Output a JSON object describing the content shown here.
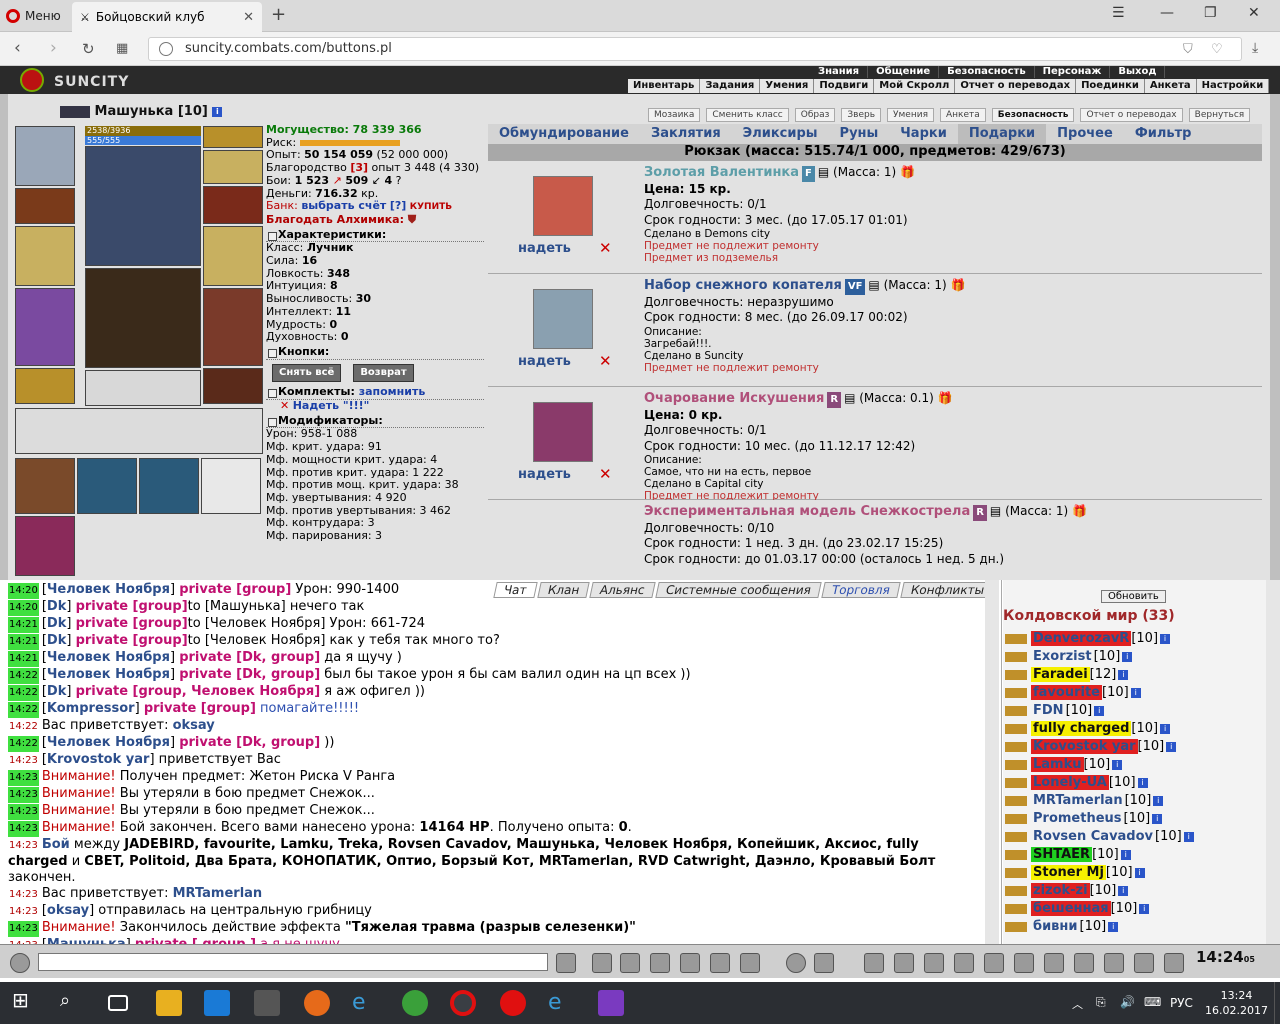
{
  "browser": {
    "menu_label": "Меню",
    "tab_title": "Бойцовский клуб",
    "url": "suncity.combats.com/buttons.pl"
  },
  "game": {
    "logo": "SUNCITY",
    "top_menu": [
      "Знания",
      "Общение",
      "Безопасность",
      "Персонаж",
      "Выход"
    ],
    "sub_menu": [
      "Инвентарь",
      "Задания",
      "Умения",
      "Подвиги",
      "Мой Скролл",
      "Отчет о переводах",
      "Поединки",
      "Анкета",
      "Настройки"
    ]
  },
  "character": {
    "name": "Машунька",
    "level": "[10]",
    "hp": "2538/3936",
    "mp": "555/555",
    "power": "Могущество: 78 339 366",
    "risk_label": "Риск:",
    "exp": "Опыт:",
    "exp_val": "50 154 059",
    "exp_next": "(52 000 000)",
    "nobility": "Благородство",
    "nobility_val": "[3]",
    "nobility_rest": "опыт 3 448 (4 330)",
    "fights": "Бои:",
    "fights_val": "1 523",
    "fights_w": "509",
    "fights_d": "4",
    "money": "Деньги:",
    "money_val": "716.32",
    "money_unit": "кр.",
    "bank": "Банк:",
    "bank_link": "выбрать счёт",
    "bank_q": "[?]",
    "bank_buy": "КУПИТЬ",
    "thank": "Благодать Алхимика:",
    "sec_chars": "Характеристики:",
    "class": "Класс:",
    "class_val": "Лучник",
    "str": "Сила:",
    "str_val": "16",
    "agi": "Ловкость:",
    "agi_val": "348",
    "int": "Интуиция:",
    "int_val": "8",
    "end": "Выносливость:",
    "end_val": "30",
    "intel": "Интеллект:",
    "intel_val": "11",
    "wis": "Мудрость:",
    "wis_val": "0",
    "spir": "Духовность:",
    "spir_val": "0",
    "sec_buttons": "Кнопки:",
    "btn_remove": "Снять всё",
    "btn_return": "Возврат",
    "sec_sets": "Комплекты:",
    "remember": "запомнить",
    "set_name": "Надеть \"!!!\"",
    "sec_mods": "Модификаторы:",
    "mods": [
      "Урон: 958-1 088",
      "Мф. крит. удара: 91",
      "Мф. мощности крит. удара: 4",
      "Мф. против крит. удара: 1 222",
      "Мф. против мощ. крит. удара: 38",
      "Мф. увертывания: 4 920",
      "Мф. против увертывания: 3 462",
      "Мф. контрудара: 3",
      "Мф. парирования: 3"
    ]
  },
  "panel": {
    "top_buttons": [
      "Мозаика",
      "Сменить класс",
      "Образ",
      "Зверь",
      "Умения",
      "Анкета",
      "Безопасность",
      "Отчет о переводах",
      "Вернуться"
    ],
    "tabs": [
      "Обмундирование",
      "Заклятия",
      "Эликсиры",
      "Руны",
      "Чарки",
      "Подарки",
      "Прочее",
      "Фильтр"
    ],
    "active_tab": "Подарки",
    "backpack": "Рюкзак (масса: 515.74/1 000, предметов: 429/673)",
    "wear_label": "надеть",
    "items": [
      {
        "name": "Золотая Валентинка",
        "tag": "F",
        "mass": "(Масса: 1)",
        "lines": [
          "Цена: 15 кр.",
          "Долговечность: 0/1",
          "Срок годности: 3 мес. (до 17.05.17 01:01)"
        ],
        "small": [
          "Сделано в Demons city"
        ],
        "warn": [
          "Предмет не подлежит ремонту",
          "Предмет из подземелья"
        ]
      },
      {
        "name": "Набор снежного копателя",
        "tag": "VF",
        "mass": "(Масса: 1)",
        "lines": [
          "Долговечность: неразрушимо",
          "Срок годности: 8 мес. (до 26.09.17 00:02)"
        ],
        "small": [
          "Описание:",
          "Загребай!!!.",
          "Сделано в Suncity"
        ],
        "warn": [
          "Предмет не подлежит ремонту"
        ]
      },
      {
        "name": "Очарование Искушения",
        "tag": "R",
        "mass": "(Масса: 0.1)",
        "lines": [
          "Цена: 0 кр.",
          "Долговечность: 0/1",
          "Срок годности: 10 мес. (до 11.12.17 12:42)"
        ],
        "small": [
          "Описание:",
          "Самое, что ни на есть, первое",
          "Сделано в Capital city"
        ],
        "warn": [
          "Предмет не подлежит ремонту"
        ]
      },
      {
        "name": "Экспериментальная модель Снежкострела",
        "tag": "R",
        "mass": "(Масса: 1)",
        "lines": [
          "Долговечность: 0/10",
          "Срок годности: 1 нед. 3 дн. (до 23.02.17 15:25)",
          "Срок годности: до 01.03.17 00:00 (осталось 1 нед. 5 дн.)"
        ],
        "small": [],
        "warn": []
      }
    ]
  },
  "chat": {
    "tabs": [
      "Чат",
      "Клан",
      "Альянс",
      "Системные сообщения",
      "Торговля",
      "Конфликты"
    ],
    "lines": [
      {
        "t": "14:20",
        "parts": [
          [
            "",
            "["
          ],
          [
            "nick",
            "Человек Ноября"
          ],
          [
            "",
            "] "
          ],
          [
            "priv",
            "private [group]"
          ],
          [
            "",
            " Урон: 990-1400"
          ]
        ]
      },
      {
        "t": "14:20",
        "parts": [
          [
            "",
            "["
          ],
          [
            "nick",
            "Dk"
          ],
          [
            "",
            "] "
          ],
          [
            "priv",
            "private [group]"
          ],
          [
            "",
            "to [Машунька] нечего так"
          ]
        ]
      },
      {
        "t": "14:21",
        "parts": [
          [
            "",
            "["
          ],
          [
            "nick",
            "Dk"
          ],
          [
            "",
            "] "
          ],
          [
            "priv",
            "private [group]"
          ],
          [
            "",
            "to [Человек Ноября] Урон: 661-724"
          ]
        ]
      },
      {
        "t": "14:21",
        "parts": [
          [
            "",
            "["
          ],
          [
            "nick",
            "Dk"
          ],
          [
            "",
            "] "
          ],
          [
            "priv",
            "private [group]"
          ],
          [
            "",
            "to [Человек Ноября] как у тебя так много то?"
          ]
        ]
      },
      {
        "t": "14:21",
        "parts": [
          [
            "",
            "["
          ],
          [
            "nick",
            "Человек Ноября"
          ],
          [
            "",
            "] "
          ],
          [
            "priv",
            "private [Dk, group]"
          ],
          [
            "",
            " да я щучу )"
          ]
        ]
      },
      {
        "t": "14:22",
        "parts": [
          [
            "",
            "["
          ],
          [
            "nick",
            "Человек Ноября"
          ],
          [
            "",
            "] "
          ],
          [
            "priv",
            "private [Dk, group]"
          ],
          [
            "",
            " был бы такое урон я бы сам валил один на цп всех ))"
          ]
        ]
      },
      {
        "t": "14:22",
        "parts": [
          [
            "",
            "["
          ],
          [
            "nick",
            "Dk"
          ],
          [
            "",
            "] "
          ],
          [
            "priv",
            "private [group, Человек Ноября]"
          ],
          [
            "",
            " я аж офигел ))"
          ]
        ]
      },
      {
        "t": "14:22",
        "parts": [
          [
            "",
            "["
          ],
          [
            "nick",
            "Kompressor"
          ],
          [
            "",
            "] "
          ],
          [
            "priv",
            "private [group]"
          ],
          [
            "nick2",
            " помагайте!!!!!"
          ]
        ]
      },
      {
        "t": "14:22",
        "n": 1,
        "parts": [
          [
            "",
            "Вас приветствует: "
          ],
          [
            "nick",
            "oksay"
          ]
        ]
      },
      {
        "t": "14:22",
        "parts": [
          [
            "",
            "["
          ],
          [
            "nick",
            "Человек Ноября"
          ],
          [
            "",
            "] "
          ],
          [
            "priv",
            "private [Dk, group]"
          ],
          [
            "",
            " ))"
          ]
        ]
      },
      {
        "t": "14:23",
        "n": 1,
        "parts": [
          [
            "",
            "["
          ],
          [
            "nick",
            "Krovostok yar"
          ],
          [
            "",
            "] приветствует Вас"
          ]
        ]
      },
      {
        "t": "14:23",
        "parts": [
          [
            "warn",
            "Внимание!"
          ],
          [
            "",
            " Получен предмет: Жетон Риска V Ранга"
          ]
        ]
      },
      {
        "t": "14:23",
        "parts": [
          [
            "warn",
            "Внимание!"
          ],
          [
            "",
            " Вы утеряли в бою предмет Снежок..."
          ]
        ]
      },
      {
        "t": "14:23",
        "parts": [
          [
            "warn",
            "Внимание!"
          ],
          [
            "",
            " Вы утеряли в бою предмет Снежок..."
          ]
        ]
      },
      {
        "t": "14:23",
        "parts": [
          [
            "warn",
            "Внимание!"
          ],
          [
            "",
            " Бой закончен. Всего вами нанесено урона: "
          ],
          [
            "b",
            "14164 HP"
          ],
          [
            "",
            ". Получено опыта: "
          ],
          [
            "b",
            "0"
          ],
          [
            "",
            "."
          ]
        ]
      },
      {
        "t": "14:23",
        "n": 1,
        "parts": [
          [
            "nick",
            "Бой"
          ],
          [
            "",
            " между "
          ],
          [
            "b",
            "JADEBIRD, favourite, Lamku, Treka, Rovsen Cavadov, Машунька, Человек Ноября, Копейшик, Аксиос, fully"
          ]
        ]
      },
      {
        "t": "",
        "parts": [
          [
            "b",
            "charged"
          ],
          [
            "",
            " и "
          ],
          [
            "b",
            "CBET, Politoid, Два Брата, КОНОПАТИК, Оптио, Борзый Кот, MRTamerlan, RVD Catwright, Даэнло, Кровавый Болт"
          ]
        ]
      },
      {
        "t": "",
        "parts": [
          [
            "",
            "закончен."
          ]
        ]
      },
      {
        "t": "14:23",
        "n": 1,
        "parts": [
          [
            "",
            "Вас приветствует: "
          ],
          [
            "nick",
            "MRTamerlan"
          ]
        ]
      },
      {
        "t": "14:23",
        "n": 1,
        "parts": [
          [
            "",
            "["
          ],
          [
            "nick",
            "oksay"
          ],
          [
            "",
            "] отправилась на центральную грибницу"
          ]
        ]
      },
      {
        "t": "14:23",
        "parts": [
          [
            "warn",
            "Внимание!"
          ],
          [
            "",
            " Закончилось действие эффекта "
          ],
          [
            "b",
            "\"Тяжелая травма (разрыв селезенки)\""
          ]
        ]
      },
      {
        "t": "14:23",
        "n": 1,
        "parts": [
          [
            "",
            "["
          ],
          [
            "nick",
            "Машунька"
          ],
          [
            "",
            "] "
          ],
          [
            "priv",
            "private [ group ]"
          ],
          [
            "priv2",
            " а я не шучу"
          ]
        ]
      }
    ]
  },
  "online": {
    "refresh": "Обновить",
    "title": "Колдовской мир (33)",
    "users": [
      {
        "name": "DenverozavR",
        "lvl": "[10]",
        "hl": "red"
      },
      {
        "name": "Exorzist",
        "lvl": "[10]",
        "hl": ""
      },
      {
        "name": "Faradei",
        "lvl": "[12]",
        "hl": "yel"
      },
      {
        "name": "favourite",
        "lvl": "[10]",
        "hl": "red"
      },
      {
        "name": "FDN",
        "lvl": "[10]",
        "hl": ""
      },
      {
        "name": "fully charged",
        "lvl": "[10]",
        "hl": "yel"
      },
      {
        "name": "Krovostok yar",
        "lvl": "[10]",
        "hl": "red"
      },
      {
        "name": "Lamku",
        "lvl": "[10]",
        "hl": "red"
      },
      {
        "name": "Lonely-UA",
        "lvl": "[10]",
        "hl": "red"
      },
      {
        "name": "MRTamerlan",
        "lvl": "[10]",
        "hl": ""
      },
      {
        "name": "Prometheus",
        "lvl": "[10]",
        "hl": ""
      },
      {
        "name": "Rovsen Cavadov",
        "lvl": "[10]",
        "hl": ""
      },
      {
        "name": "SHTAER",
        "lvl": "[10]",
        "hl": "grn"
      },
      {
        "name": "Stoner Mj",
        "lvl": "[10]",
        "hl": "yel"
      },
      {
        "name": "zizok-zi",
        "lvl": "[10]",
        "hl": "red"
      },
      {
        "name": "бешенная",
        "lvl": "[10]",
        "hl": "red"
      },
      {
        "name": "бивни",
        "lvl": "[10]",
        "hl": ""
      }
    ]
  },
  "clock": "14:24",
  "clock_sec": "05",
  "taskbar": {
    "lang": "РУС",
    "time": "13:24",
    "date": "16.02.2017"
  }
}
